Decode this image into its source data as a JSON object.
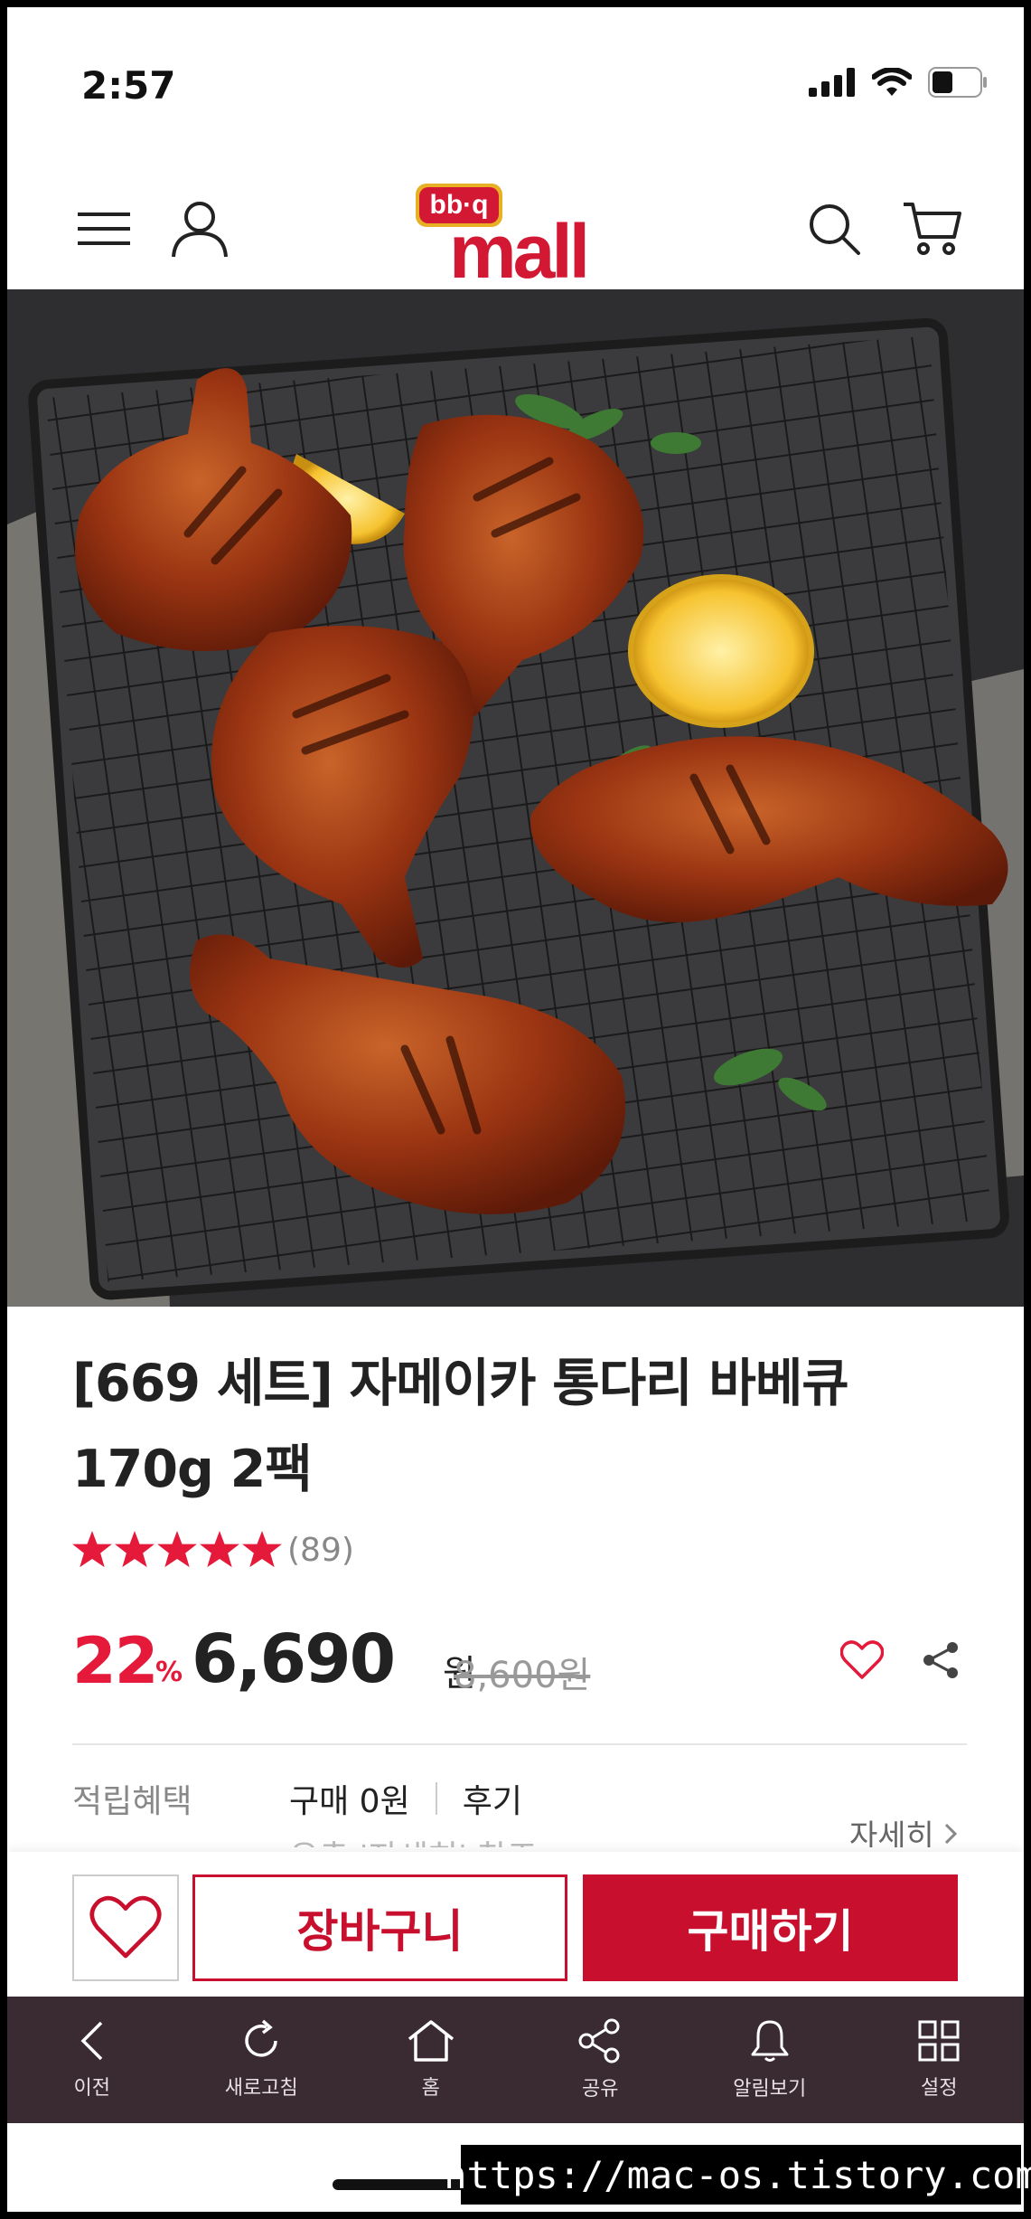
{
  "status_bar": {
    "time": "2:57"
  },
  "header": {
    "logo_top": "bb·q",
    "logo_bottom": "mall"
  },
  "product": {
    "title_line1": "[669 세트] 자메이카 통다리 바베큐",
    "title_line2": "170g 2팩",
    "rating_stars": 5,
    "review_count": "(89)",
    "discount": "22",
    "discount_unit": "%",
    "price": "6,690",
    "price_unit": "원",
    "original_price": "8,600원"
  },
  "benefit": {
    "label": "적립혜택",
    "purchase": "구매 0원",
    "review": "후기",
    "note": "우측 '자세히' 참조",
    "more_label": "자세히"
  },
  "actions": {
    "cart_label": "장바구니",
    "buy_label": "구매하기"
  },
  "bottom_nav": [
    {
      "label": "이전",
      "icon": "back-icon"
    },
    {
      "label": "새로고침",
      "icon": "refresh-icon"
    },
    {
      "label": "홈",
      "icon": "home-icon"
    },
    {
      "label": "공유",
      "icon": "share-icon"
    },
    {
      "label": "알림보기",
      "icon": "bell-icon"
    },
    {
      "label": "설정",
      "icon": "grid-icon"
    }
  ],
  "watermark": "https://mac-os.tistory.com",
  "colors": {
    "brand_red": "#c8102e",
    "discount_red": "#e5193a",
    "nav_bg": "#3a2b33"
  }
}
